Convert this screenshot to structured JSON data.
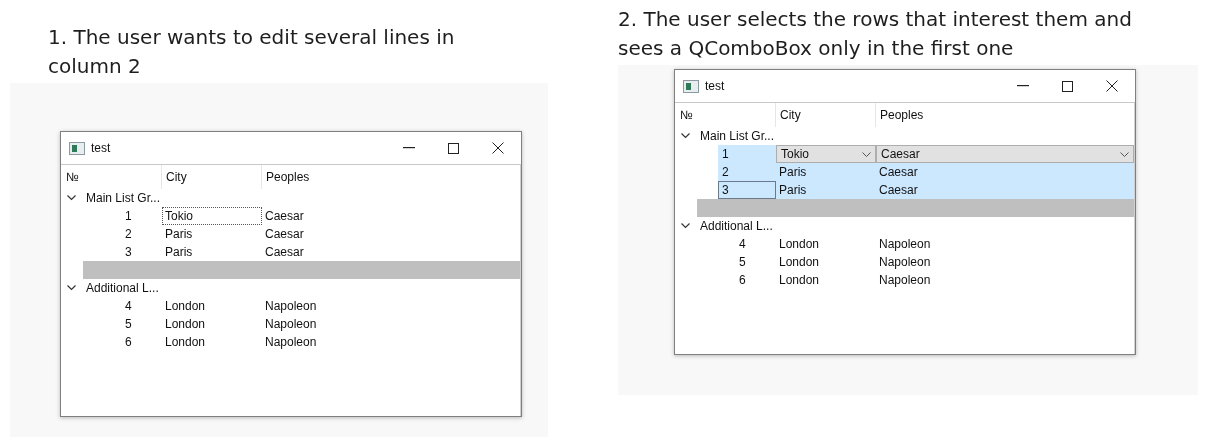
{
  "panels": [
    {
      "caption": "1. The user wants to edit several lines in column 2",
      "window": {
        "title": "test"
      },
      "columns": [
        "№",
        "City",
        "Peoples"
      ],
      "groups": [
        {
          "label": "Main List Gr...",
          "expanded": true,
          "rows": [
            {
              "kind": "item",
              "selected": false,
              "cells": [
                {
                  "text": "1",
                  "kind": "text"
                },
                {
                  "text": "Tokio",
                  "kind": "text",
                  "focused": true
                },
                {
                  "text": "Caesar",
                  "kind": "text"
                }
              ]
            },
            {
              "kind": "item",
              "selected": false,
              "cells": [
                {
                  "text": "2",
                  "kind": "text"
                },
                {
                  "text": "Paris",
                  "kind": "text"
                },
                {
                  "text": "Caesar",
                  "kind": "text"
                }
              ]
            },
            {
              "kind": "item",
              "selected": false,
              "cells": [
                {
                  "text": "3",
                  "kind": "text"
                },
                {
                  "text": "Paris",
                  "kind": "text"
                },
                {
                  "text": "Caesar",
                  "kind": "text"
                }
              ]
            },
            {
              "kind": "spacer"
            }
          ]
        },
        {
          "label": "Additional L...",
          "expanded": true,
          "rows": [
            {
              "kind": "item",
              "selected": false,
              "cells": [
                {
                  "text": "4",
                  "kind": "text"
                },
                {
                  "text": "London",
                  "kind": "text"
                },
                {
                  "text": "Napoleon",
                  "kind": "text"
                }
              ]
            },
            {
              "kind": "item",
              "selected": false,
              "cells": [
                {
                  "text": "5",
                  "kind": "text"
                },
                {
                  "text": "London",
                  "kind": "text"
                },
                {
                  "text": "Napoleon",
                  "kind": "text"
                }
              ]
            },
            {
              "kind": "item",
              "selected": false,
              "cells": [
                {
                  "text": "6",
                  "kind": "text"
                },
                {
                  "text": "London",
                  "kind": "text"
                },
                {
                  "text": "Napoleon",
                  "kind": "text"
                }
              ]
            }
          ]
        }
      ]
    },
    {
      "caption": "2. The user selects the rows that interest them and sees a QComboBox only in the first one",
      "window": {
        "title": "test"
      },
      "columns": [
        "№",
        "City",
        "Peoples"
      ],
      "groups": [
        {
          "label": "Main List Gr...",
          "expanded": true,
          "rows": [
            {
              "kind": "item",
              "selected": true,
              "cells": [
                {
                  "text": "1",
                  "kind": "text"
                },
                {
                  "text": "Tokio",
                  "kind": "combo"
                },
                {
                  "text": "Caesar",
                  "kind": "combo"
                }
              ]
            },
            {
              "kind": "item",
              "selected": true,
              "cells": [
                {
                  "text": "2",
                  "kind": "text"
                },
                {
                  "text": "Paris",
                  "kind": "text"
                },
                {
                  "text": "Caesar",
                  "kind": "text"
                }
              ]
            },
            {
              "kind": "item",
              "selected": true,
              "cells": [
                {
                  "text": "3",
                  "kind": "text",
                  "focused": true
                },
                {
                  "text": "Paris",
                  "kind": "text"
                },
                {
                  "text": "Caesar",
                  "kind": "text"
                }
              ]
            },
            {
              "kind": "spacer"
            }
          ]
        },
        {
          "label": "Additional L...",
          "expanded": true,
          "rows": [
            {
              "kind": "item",
              "selected": false,
              "cells": [
                {
                  "text": "4",
                  "kind": "text"
                },
                {
                  "text": "London",
                  "kind": "text"
                },
                {
                  "text": "Napoleon",
                  "kind": "text"
                }
              ]
            },
            {
              "kind": "item",
              "selected": false,
              "cells": [
                {
                  "text": "5",
                  "kind": "text"
                },
                {
                  "text": "London",
                  "kind": "text"
                },
                {
                  "text": "Napoleon",
                  "kind": "text"
                }
              ]
            },
            {
              "kind": "item",
              "selected": false,
              "cells": [
                {
                  "text": "6",
                  "kind": "text"
                },
                {
                  "text": "London",
                  "kind": "text"
                },
                {
                  "text": "Napoleon",
                  "kind": "text"
                }
              ]
            }
          ]
        }
      ]
    }
  ]
}
